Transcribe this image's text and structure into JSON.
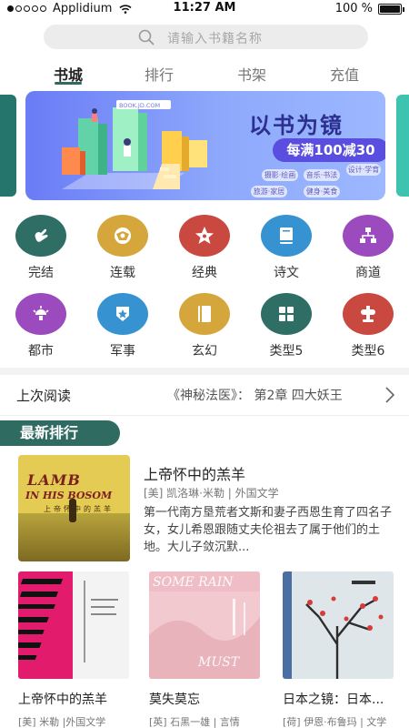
{
  "status_bar": {
    "carrier": "Applidium",
    "time": "11:27 AM",
    "battery": "100 %"
  },
  "search": {
    "placeholder": "请输入书籍名称"
  },
  "tabs": [
    {
      "label": "书城",
      "active": true
    },
    {
      "label": "排行",
      "active": false
    },
    {
      "label": "书架",
      "active": false
    },
    {
      "label": "充值",
      "active": false
    }
  ],
  "banner": {
    "site": "BOOK.JD.COM",
    "title": "以书为镜",
    "promo": "每满100减30",
    "tags": [
      "摄影·绘画",
      "音乐·书法",
      "设计·学育",
      "旅游·家居",
      "健身·美食"
    ]
  },
  "categories": [
    {
      "label": "完结",
      "color": "#2e6e64",
      "icon": "hand-icon"
    },
    {
      "label": "连载",
      "color": "#d4a63c",
      "icon": "ball-icon"
    },
    {
      "label": "经典",
      "color": "#c9483f",
      "icon": "star-icon"
    },
    {
      "label": "诗文",
      "color": "#3692d0",
      "icon": "book-icon"
    },
    {
      "label": "商道",
      "color": "#9b4bbd",
      "icon": "org-chart-icon"
    },
    {
      "label": "都市",
      "color": "#9b4bbd",
      "icon": "lamp-icon"
    },
    {
      "label": "军事",
      "color": "#3692d0",
      "icon": "badge-icon"
    },
    {
      "label": "玄幻",
      "color": "#d4a63c",
      "icon": "notebook-icon"
    },
    {
      "label": "类型5",
      "color": "#2e6e64",
      "icon": "grid-icon"
    },
    {
      "label": "类型6",
      "color": "#c9483f",
      "icon": "stand-icon"
    }
  ],
  "last_read": {
    "label": "上次阅读",
    "book": "《神秘法医》： 第2章  四大妖王"
  },
  "ranking": {
    "header": "最新排行",
    "featured": {
      "title": "上帝怀中的羔羊",
      "meta": "[美] 凯洛琳·米勒 |  外国文学",
      "description": "第一代南方垦荒者文斯和妻子西恩生育了四名子女，女儿希恩跟随丈夫伦祖去了属于他们的土地。大儿子敛沉默...",
      "cover": {
        "title_line1": "LAMB",
        "title_line2": "IN HIS BOSOM",
        "cn": "上帝怀中的羔羊"
      }
    },
    "books": [
      {
        "title": "上帝怀中的羔羊",
        "meta": "[美] 米勒 |外国文学"
      },
      {
        "title": "莫失莫忘",
        "meta": "[英] 石黑一雄 | 言情"
      },
      {
        "title": "日本之镜：日本...",
        "meta": "[荷] 伊恩·布鲁玛 | 文学"
      }
    ]
  }
}
